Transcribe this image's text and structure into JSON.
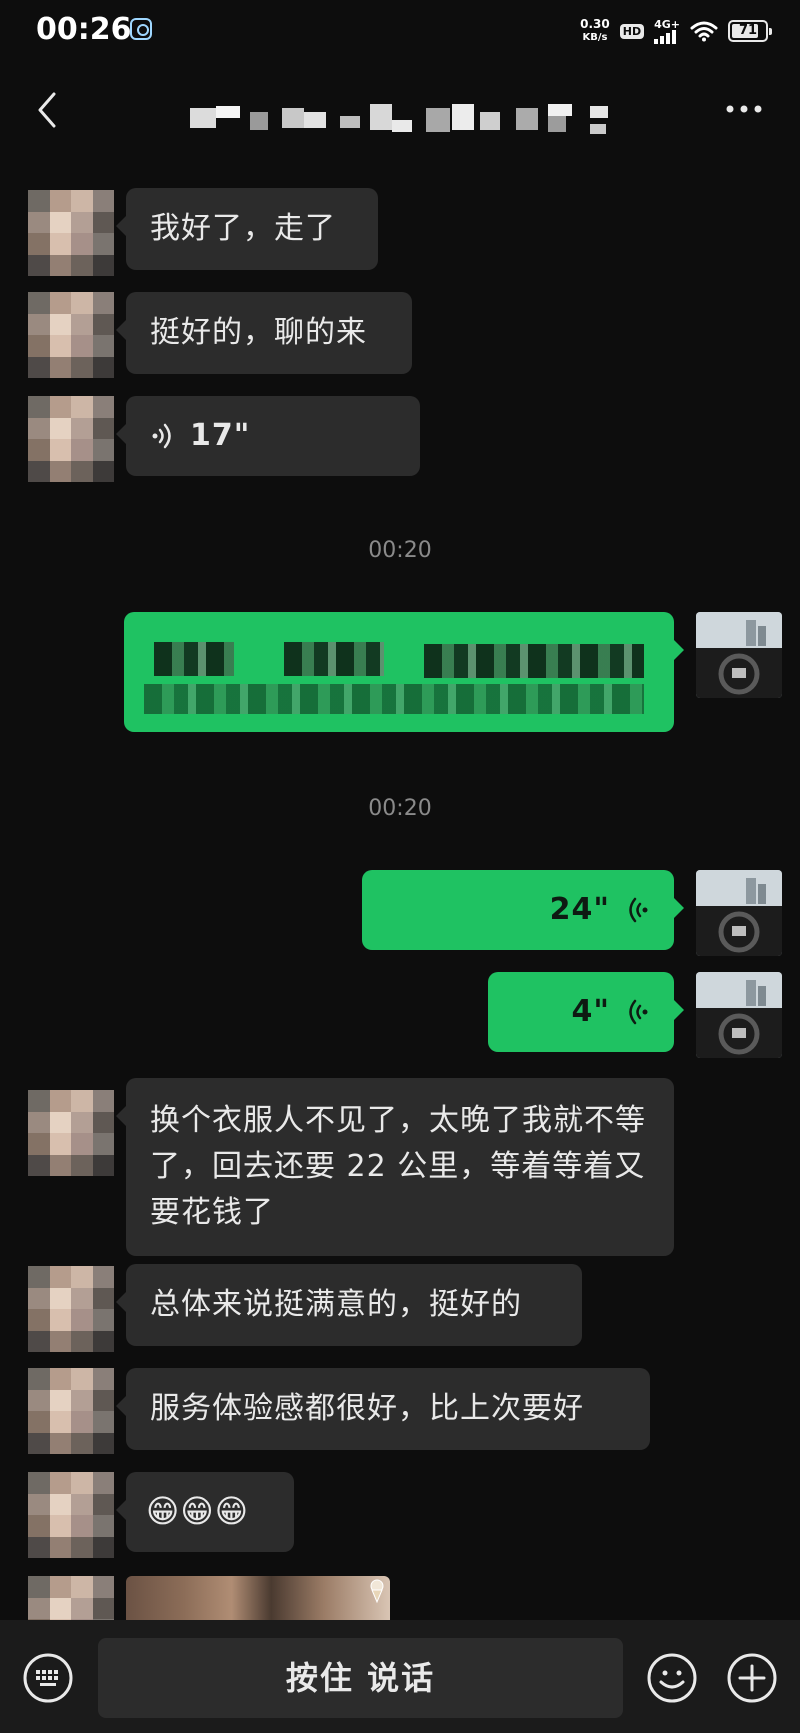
{
  "status_bar": {
    "time": "00:26",
    "net_speed_value": "0.30",
    "net_speed_unit": "KB/s",
    "hd_label": "HD",
    "signal_label": "4G+",
    "battery_level": "71"
  },
  "header": {
    "back_icon": "chevron-left-icon",
    "more_icon": "more-dots-icon"
  },
  "messages": [
    {
      "side": "in",
      "text": "我好了，走了"
    },
    {
      "side": "in",
      "text": "挺好的，聊的来"
    },
    {
      "side": "in",
      "type": "voice",
      "duration": "17\""
    },
    {
      "type": "time",
      "text": "00:20"
    },
    {
      "side": "out",
      "type": "redacted",
      "line1": "…",
      "line2": "下次，……，……的？"
    },
    {
      "type": "time",
      "text": "00:20"
    },
    {
      "side": "out",
      "type": "voice",
      "duration": "24\""
    },
    {
      "side": "out",
      "type": "voice",
      "duration": "4\""
    },
    {
      "side": "in",
      "text": "换个衣服人不见了，太晚了我就不等了，回去还要 22 公里，等着等着又要花钱了"
    },
    {
      "side": "in",
      "text": "总体来说挺满意的，挺好的"
    },
    {
      "side": "in",
      "text": "服务体验感都很好，比上次要好"
    },
    {
      "side": "in",
      "text": "😁😁😁"
    },
    {
      "side": "in",
      "type": "image"
    }
  ],
  "bottom_bar": {
    "talk_label": "按住 说话"
  },
  "colors": {
    "background": "#0d0d0d",
    "incoming_bubble": "#2c2c2c",
    "outgoing_bubble": "#1fc262",
    "input_bar": "#1b1b1b"
  }
}
